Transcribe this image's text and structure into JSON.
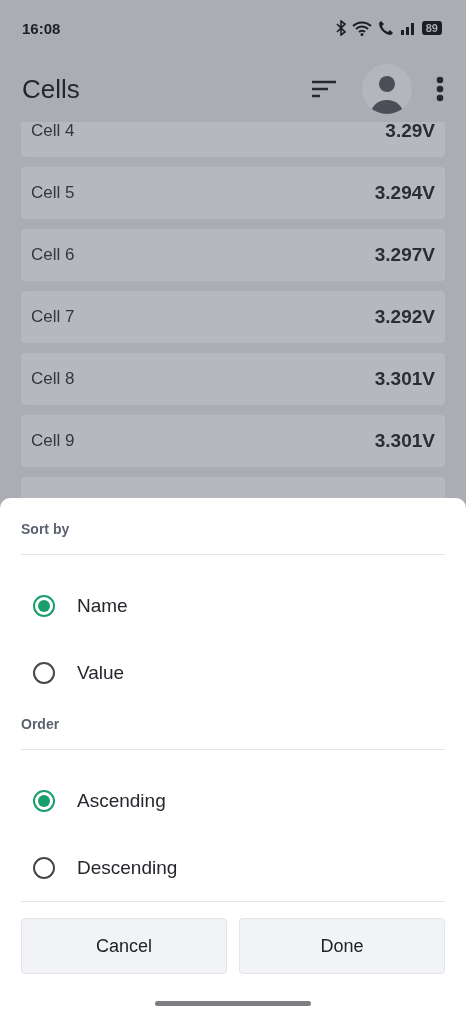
{
  "status_bar": {
    "time": "16:08",
    "battery": "89"
  },
  "app_bar": {
    "title": "Cells"
  },
  "cells": [
    {
      "name": "Cell 4",
      "value": "3.29V"
    },
    {
      "name": "Cell 5",
      "value": "3.294V"
    },
    {
      "name": "Cell 6",
      "value": "3.297V"
    },
    {
      "name": "Cell 7",
      "value": "3.292V"
    },
    {
      "name": "Cell 8",
      "value": "3.301V"
    },
    {
      "name": "Cell 9",
      "value": "3.301V"
    }
  ],
  "sheet": {
    "sections": [
      {
        "title": "Sort by",
        "options": [
          {
            "label": "Name",
            "selected": true
          },
          {
            "label": "Value",
            "selected": false
          }
        ]
      },
      {
        "title": "Order",
        "options": [
          {
            "label": "Ascending",
            "selected": true
          },
          {
            "label": "Descending",
            "selected": false
          }
        ]
      }
    ],
    "buttons": [
      "Cancel",
      "Done"
    ]
  }
}
